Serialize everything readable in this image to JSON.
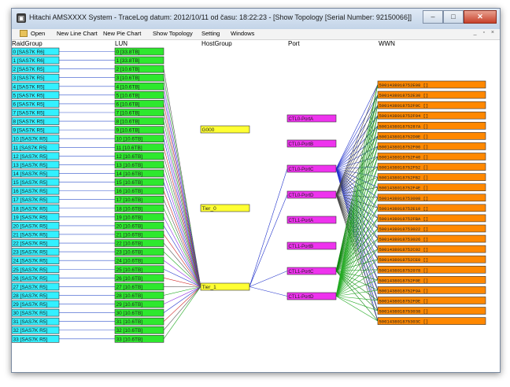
{
  "window": {
    "title": "Hitachi AMSXXXX System - TraceLog datum: 2012/10/11 od času: 18:22:23 - [Show Topology [Serial Number: 92150066]]",
    "buttons": {
      "minimize": "–",
      "maximize": "□",
      "close": "✕"
    },
    "mdi_buttons": "_ ▫ ×",
    "app_icon": "terminal-icon"
  },
  "menu": [
    "Open",
    "New Line Chart",
    "New Pie Chart",
    "Show Topology",
    "Setting",
    "Windows"
  ],
  "columns": {
    "raidgroup": "RaidGroup",
    "lun": "LUN",
    "hostgroup": "HostGroup",
    "port": "Port",
    "wwn": "WWN"
  },
  "colors": {
    "raidgroup": "#33f0ff",
    "lun": "#2ee82e",
    "hostgroup": "#ffff33",
    "port": "#ee33ee",
    "wwn": "#ff8800"
  },
  "raid_groups": [
    "0 [SAS7K R6]",
    "1 [SAS7K R6]",
    "2 [SAS7K R5]",
    "3 [SAS7K R5]",
    "4 [SAS7K R5]",
    "5 [SAS7K R5]",
    "6 [SAS7K R5]",
    "7 [SAS7K R5]",
    "8 [SAS7K R5]",
    "9 [SAS7K R5]",
    "10 [SAS7K R5]",
    "11 [SAS7K R5]",
    "12 [SAS7K R5]",
    "13 [SAS7K R5]",
    "14 [SAS7K R5]",
    "15 [SAS7K R5]",
    "16 [SAS7K R5]",
    "17 [SAS7K R5]",
    "18 [SAS7K R5]",
    "19 [SAS7K R5]",
    "20 [SAS7K R5]",
    "21 [SAS7K R5]",
    "22 [SAS7K R5]",
    "23 [SAS7K R5]",
    "24 [SAS7K R5]",
    "25 [SAS7K R5]",
    "26 [SAS7K R5]",
    "27 [SAS7K R5]",
    "28 [SAS7K R5]",
    "29 [SAS7K R5]",
    "30 [SAS7K R5]",
    "31 [SAS7K R5]",
    "32 [SAS7K R5]",
    "33 [SAS7K R5]"
  ],
  "luns": [
    "0 [33.8TB]",
    "1 [33.8TB]",
    "2 [10.6TB]",
    "3 [10.6TB]",
    "4 [10.6TB]",
    "5 [10.6TB]",
    "6 [10.6TB]",
    "7 [10.6TB]",
    "8 [10.6TB]",
    "9 [10.6TB]",
    "10 [10.6TB]",
    "11 [10.6TB]",
    "12 [10.6TB]",
    "13 [10.6TB]",
    "14 [10.6TB]",
    "15 [10.6TB]",
    "16 [10.6TB]",
    "17 [10.6TB]",
    "18 [10.6TB]",
    "19 [10.6TB]",
    "20 [10.6TB]",
    "21 [10.6TB]",
    "22 [10.6TB]",
    "23 [10.6TB]",
    "24 [10.6TB]",
    "25 [10.6TB]",
    "26 [10.6TB]",
    "27 [10.6TB]",
    "28 [10.6TB]",
    "29 [10.6TB]",
    "30 [10.6TB]",
    "31 [10.6TB]",
    "32 [10.6TB]",
    "33 [10.6TB]"
  ],
  "hostgroups": [
    "G000",
    "Tier_0",
    "Tier_1"
  ],
  "ports": [
    "CTL0-PortA",
    "CTL0-PortB",
    "CTL0-PortC",
    "CTL0-PortD",
    "CTL1-PortA",
    "CTL1-PortB",
    "CTL1-PortC",
    "CTL1-PortD"
  ],
  "wwns": [
    "5001438018752E08 []",
    "5001438018752E30 []",
    "5001438018752F0C []",
    "5001438018752F94 []",
    "500143801875287A []",
    "5001438018752D0E []",
    "5001438018752F06 []",
    "5001438018752F40 []",
    "5001438018752F52 []",
    "5001438018752FB2 []",
    "5001438018752F4E []",
    "5001438018753008 []",
    "5001438018752E10 []",
    "5001438018752FBA []",
    "5001438018753022 []",
    "5001438018753026 []",
    "5001438018752C02 []",
    "5001438018752CE0 []",
    "5001438018752078 []",
    "5001438018752F0E []",
    "5001438018752F9A []",
    "5001438018752FDE []",
    "5001438018753038 []",
    "500143801875303C []"
  ]
}
